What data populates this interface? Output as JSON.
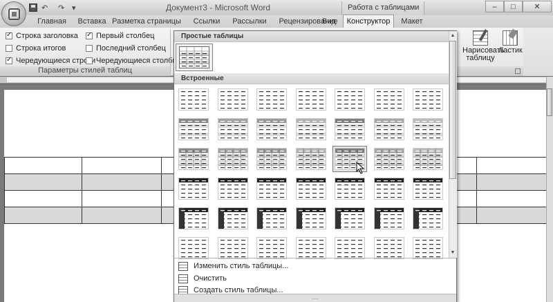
{
  "window": {
    "title": "Документ3 - Microsoft Word",
    "context_title": "Работа с таблицами",
    "controls": {
      "minimize": "–",
      "maximize": "□",
      "close": "✕"
    }
  },
  "qat": {
    "undo": "↶",
    "redo": "↷",
    "more": "▾"
  },
  "tabs": [
    {
      "label": "Главная",
      "active": false
    },
    {
      "label": "Вставка",
      "active": false
    },
    {
      "label": "Разметка страницы",
      "active": false
    },
    {
      "label": "Ссылки",
      "active": false
    },
    {
      "label": "Рассылки",
      "active": false
    },
    {
      "label": "Рецензирование",
      "active": false
    },
    {
      "label": "Вид",
      "active": false
    },
    {
      "label": "Конструктор",
      "active": true
    },
    {
      "label": "Макет",
      "active": false
    }
  ],
  "style_options": {
    "group_label": "Параметры стилей таблиц",
    "items": [
      {
        "label": "Строка заголовка",
        "checked": true
      },
      {
        "label": "Строка итогов",
        "checked": false
      },
      {
        "label": "Чередующиеся строки",
        "checked": true
      },
      {
        "label": "Первый столбец",
        "checked": true
      },
      {
        "label": "Последний столбец",
        "checked": false
      },
      {
        "label": "Чередующиеся столбцы",
        "checked": false
      }
    ]
  },
  "draw_group": {
    "draw_label_1": "Нарисовать",
    "draw_label_2": "таблицу",
    "eraser_label": "Ластик"
  },
  "gallery": {
    "simple_header": "Простые таблицы",
    "builtin_header": "Встроенные",
    "scroll_up": "▲",
    "scroll_down": "▼",
    "grip": "....",
    "menu": [
      {
        "label": "Изменить стиль таблицы...",
        "icon": "table-edit-icon"
      },
      {
        "label": "Очистить",
        "icon": "clear-table-icon"
      },
      {
        "label": "Создать стиль таблицы...",
        "icon": "new-table-style-icon"
      }
    ]
  },
  "colors": {
    "ribbon": "#e8e8e8",
    "active_tab": "#f3f3f3",
    "header_dark": "#222222",
    "accent_gray": "#808080"
  }
}
